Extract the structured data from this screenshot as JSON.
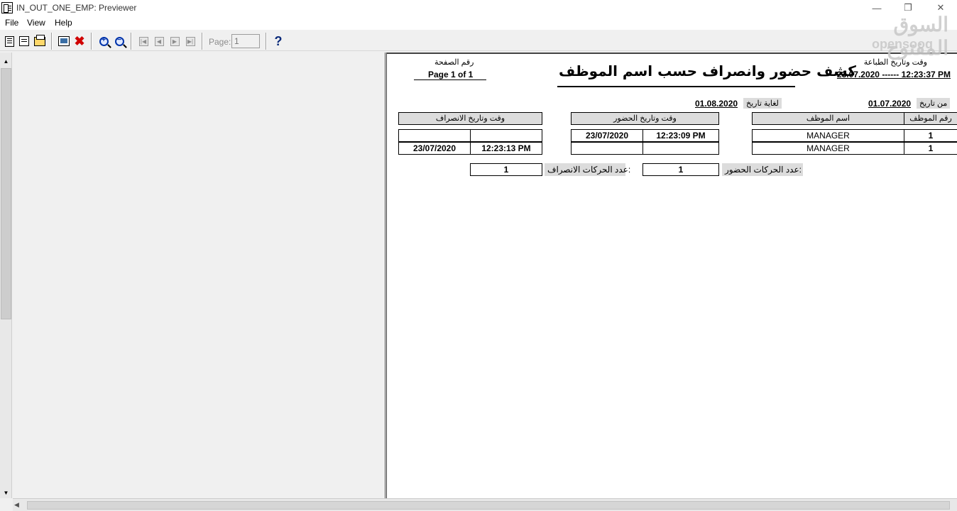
{
  "window": {
    "title": "IN_OUT_ONE_EMP: Previewer",
    "minimize": "—",
    "maximize": "❐",
    "close": "✕"
  },
  "menu": [
    "File",
    "View",
    "Help"
  ],
  "toolbar": {
    "page_label": "Page:",
    "page_value": "1",
    "icons": [
      "print-all-icon",
      "print-setup-icon",
      "print-icon",
      "preview-screen-icon",
      "close-x-icon",
      "zoom-in-icon",
      "zoom-out-icon",
      "first-page-icon",
      "prev-page-icon",
      "next-page-icon",
      "last-page-icon",
      "help-icon"
    ]
  },
  "watermark": {
    "arabic": "السوق المفتوح",
    "latin": "opensooq"
  },
  "report": {
    "print_datetime_label": "وقت وتاريخ الطباعة",
    "print_datetime_value": "23.07.2020 ------ 12:23:37 PM",
    "title": "كشف حضور وانصراف حسب اسم الموظف",
    "page_number_label": "رقم الصفحة",
    "page_number_value": "Page 1 of 1",
    "from_date_label": "من تاريخ",
    "from_date_value": "01.07.2020",
    "to_date_label": "لغاية تاريخ",
    "to_date_value": "01.08.2020",
    "columns": {
      "emp_no": "رقم الموظف",
      "emp_name": "اسم الموظف",
      "checkin": "وقت وتاريخ الحضور",
      "checkout": "وقت وتاريخ الانصراف"
    },
    "rows": [
      {
        "emp_no": "1",
        "emp_name": "MANAGER",
        "in_date": "23/07/2020",
        "in_time": "12:23:09 PM",
        "out_date": "",
        "out_time": ""
      },
      {
        "emp_no": "1",
        "emp_name": "MANAGER",
        "in_date": "",
        "in_time": "",
        "out_date": "23/07/2020",
        "out_time": "12:23:13 PM"
      }
    ],
    "checkin_count_label": "عدد الحركات الحضور:",
    "checkin_count_value": "1",
    "checkout_count_label": "عدد الحركات الانصراف:",
    "checkout_count_value": "1"
  }
}
